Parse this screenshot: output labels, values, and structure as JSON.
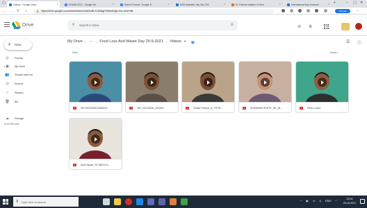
{
  "browser": {
    "tabs": [
      {
        "title": "Videos - Google Drive",
        "active": true,
        "color": "#1a73e8"
      },
      {
        "title": "ISWSM 2021 - Google Do",
        "active": false,
        "color": "#4285f4"
      },
      {
        "title": "Report Format - Google D",
        "active": false,
        "color": "#4285f4"
      },
      {
        "title": "NSS Activities July Dec 202",
        "active": false,
        "color": "#1a73e8"
      },
      {
        "title": "St. Francis Institute of Tech",
        "active": false,
        "color": "#e37400"
      },
      {
        "title": "International Day of Aware",
        "active": false,
        "color": "#1a73e8"
      }
    ],
    "new_tab": "+",
    "url": "https://drive.google.com/drive/folders/1NsEhuBL3C5NkgFKMkvNSgk-Hvz-nKsHdfk",
    "profile_label": "InPrivate"
  },
  "drive": {
    "app_name": "Drive",
    "search_placeholder": "Search in Drive"
  },
  "sidebar": {
    "new_label": "New",
    "items": [
      {
        "label": "Priority",
        "icon": "priority-icon",
        "glyph": "◎"
      },
      {
        "label": "My Drive",
        "icon": "my-drive-icon",
        "glyph": "▣"
      },
      {
        "label": "Shared with me",
        "icon": "shared-with-me-icon",
        "glyph": "👥"
      },
      {
        "label": "Recent",
        "icon": "recent-icon",
        "glyph": "◷"
      },
      {
        "label": "Starred",
        "icon": "star-icon",
        "glyph": "☆"
      },
      {
        "label": "Bin",
        "icon": "bin-icon",
        "glyph": "🗑"
      }
    ],
    "storage_label": "Storage",
    "storage_used": "21.83 GB used"
  },
  "breadcrumb": {
    "root": "My Drive",
    "ellipsis": "···",
    "folder": "Food Loss And Waste Day 29-9-2021",
    "current": "Videos"
  },
  "content": {
    "section_label": "Files",
    "sort_label": "Name",
    "files": [
      {
        "name": "VID-20210928-WA0015...",
        "thumb_bg": "#4a8fa6",
        "skin": "#8a5a3c",
        "shirt": "#2b4a7a"
      },
      {
        "name": "VID_20210928_154183...",
        "thumb_bg": "#8b7d6b",
        "skin": "#7a5236",
        "shirt": "#5a5048"
      },
      {
        "name": "Tanish Parmar_B_TEITE...",
        "thumb_bg": "#b9a48a",
        "skin": "#7b4f33",
        "shirt": "#3a3a3a"
      },
      {
        "name": "SHRAVANI SHETE_SE_IN...",
        "thumb_bg": "#c8b0a0",
        "skin": "#c69274",
        "shirt": "#6c5a73"
      },
      {
        "name": "Ftest 1.mp4",
        "thumb_bg": "#3fa58b",
        "skin": "#8f5d3f",
        "shirt": "#2f2f2f"
      },
      {
        "name": "Amit Nadar_TE MECH A...",
        "thumb_bg": "#e8e4de",
        "skin": "#8a5a3a",
        "shirt": "#7a1f2e"
      }
    ]
  },
  "taskbar": {
    "search_placeholder": "Type here to search",
    "language": "ENG",
    "time": "23:04",
    "date": "29-10-2021"
  }
}
